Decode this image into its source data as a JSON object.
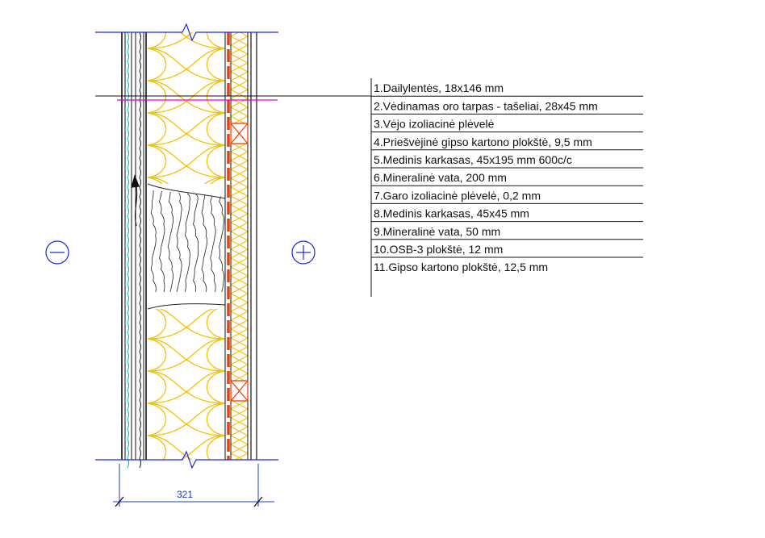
{
  "legend": {
    "items": [
      "1.Dailylentės, 18x146 mm",
      "2.Vėdinamas oro tarpas - tašeliai, 28x45 mm",
      "3.Vėjo izoliacinė plėvelė",
      "4.Priešvėjinė gipso kartono plokštė, 9,5 mm",
      "5.Medinis karkasas, 45x195 mm 600c/c",
      "6.Mineralinė vata, 200 mm",
      "7.Garo izoliacinė plėvelė, 0,2 mm",
      "8.Medinis karkasas, 45x45 mm",
      "9.Mineralinė vata, 50 mm",
      "10.OSB-3 plokštė, 12 mm",
      "11.Gipso kartono plokštė, 12,5 mm"
    ]
  },
  "dimension": {
    "value": "321"
  },
  "symbols": {
    "outside": "minus-symbol",
    "inside": "plus-symbol"
  },
  "colors": {
    "insulation": "#f5c000",
    "vapor_barrier": "#e8400a",
    "leader_line": "#e000e0",
    "dimension": "#1a3dbd",
    "wind_barrier": "#00b0b0"
  }
}
